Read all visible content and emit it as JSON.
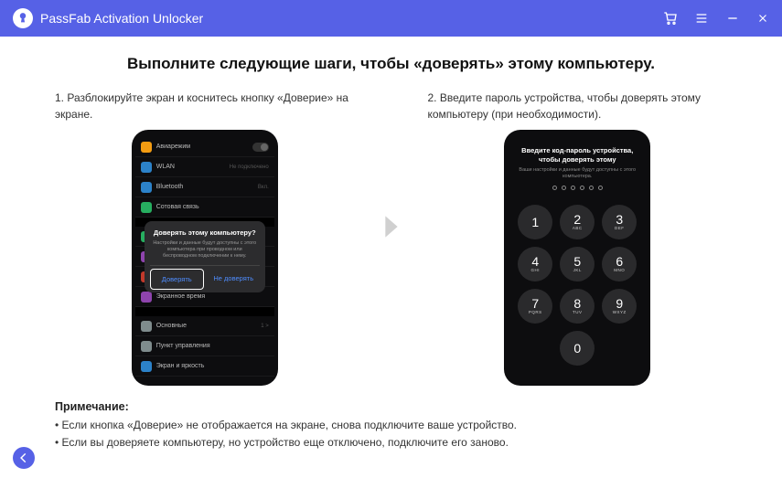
{
  "app_title": "PassFab Activation Unlocker",
  "heading": "Выполните следующие шаги, чтобы «доверять» этому компьютеру.",
  "step1_text": "1. Разблокируйте экран и коснитесь кнопку «Доверие» на экране.",
  "step2_text": "2. Введите пароль устройства, чтобы доверять этому компьютеру (при необходимости).",
  "phone1": {
    "rows": [
      {
        "color": "#f39c12",
        "label": "Авиарежим",
        "on": true
      },
      {
        "color": "#2c82c9",
        "label": "WLAN",
        "value": "Не подключено"
      },
      {
        "color": "#2c82c9",
        "label": "Bluetooth",
        "value": "Вкл."
      },
      {
        "color": "#27ae60",
        "label": "Сотовая связь"
      },
      {
        "color": "#27ae60",
        "label": ""
      },
      {
        "color": "#8e44ad",
        "label": ""
      },
      {
        "color": "#c0392b",
        "label": ""
      },
      {
        "color": "#8e44ad",
        "label": "Экранное время"
      },
      {
        "color": "#7f8c8d",
        "label": "Основные",
        "value": "1 >"
      },
      {
        "color": "#7f8c8d",
        "label": "Пункт управления"
      },
      {
        "color": "#2c82c9",
        "label": "Экран и яркость"
      }
    ],
    "modal": {
      "title": "Доверять этому компьютеру?",
      "desc": "Настройки и данные будут доступны с этого компьютера при проводном или беспроводном подключении к нему.",
      "trust": "Доверять",
      "dont_trust": "Не доверять"
    }
  },
  "phone2": {
    "title": "Введите код-пароль устройства, чтобы доверять этому",
    "sub": "Ваши настройки и данные будут доступны с этого компьютера.",
    "keys": [
      {
        "n": "1",
        "l": ""
      },
      {
        "n": "2",
        "l": "ABC"
      },
      {
        "n": "3",
        "l": "DEF"
      },
      {
        "n": "4",
        "l": "GHI"
      },
      {
        "n": "5",
        "l": "JKL"
      },
      {
        "n": "6",
        "l": "MNO"
      },
      {
        "n": "7",
        "l": "PQRS"
      },
      {
        "n": "8",
        "l": "TUV"
      },
      {
        "n": "9",
        "l": "WXYZ"
      },
      {
        "n": "",
        "l": ""
      },
      {
        "n": "0",
        "l": ""
      },
      {
        "n": "",
        "l": ""
      }
    ]
  },
  "note_label": "Примечание:",
  "note_1": "Если кнопка «Доверие» не отображается на экране, снова подключите ваше устройство.",
  "note_2": "Если вы доверяете компьютеру, но устройство еще отключено, подключите его заново."
}
